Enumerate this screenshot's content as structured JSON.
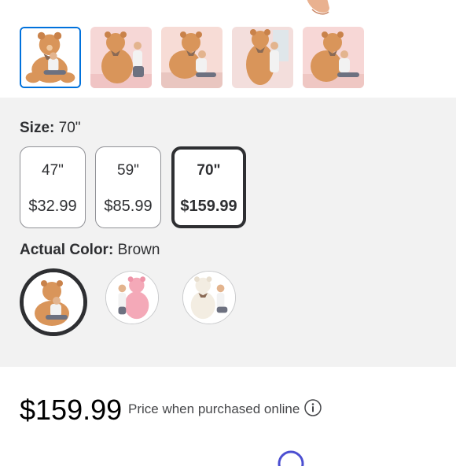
{
  "thumbnails": {
    "items": [
      {
        "alt": "bear-photo-1",
        "selected": true
      },
      {
        "alt": "bear-photo-2",
        "selected": false
      },
      {
        "alt": "bear-photo-3",
        "selected": false
      },
      {
        "alt": "bear-photo-4",
        "selected": false
      },
      {
        "alt": "bear-photo-5",
        "selected": false
      }
    ]
  },
  "size_option": {
    "label": "Size:",
    "selected_value": "70\"",
    "choices": [
      {
        "size": "47\"",
        "price": "$32.99",
        "selected": false
      },
      {
        "size": "59\"",
        "price": "$85.99",
        "selected": false
      },
      {
        "size": "70\"",
        "price": "$159.99",
        "selected": true
      }
    ]
  },
  "color_option": {
    "label": "Actual Color:",
    "selected_value": "Brown",
    "swatches": [
      {
        "icon": "brown-bear-swatch",
        "selected": true,
        "color": "#d9955a"
      },
      {
        "icon": "pink-bear-swatch",
        "selected": false,
        "color": "#f4a9b8"
      },
      {
        "icon": "white-bear-swatch",
        "selected": false,
        "color": "#f3ede2"
      }
    ]
  },
  "price": {
    "amount": "$159.99",
    "note": "Price when purchased online",
    "info_icon": "info-icon"
  },
  "colors": {
    "selected_thumb_border": "#0071dc",
    "panel_bg": "#f2f2f2",
    "text": "#2e2f32"
  }
}
